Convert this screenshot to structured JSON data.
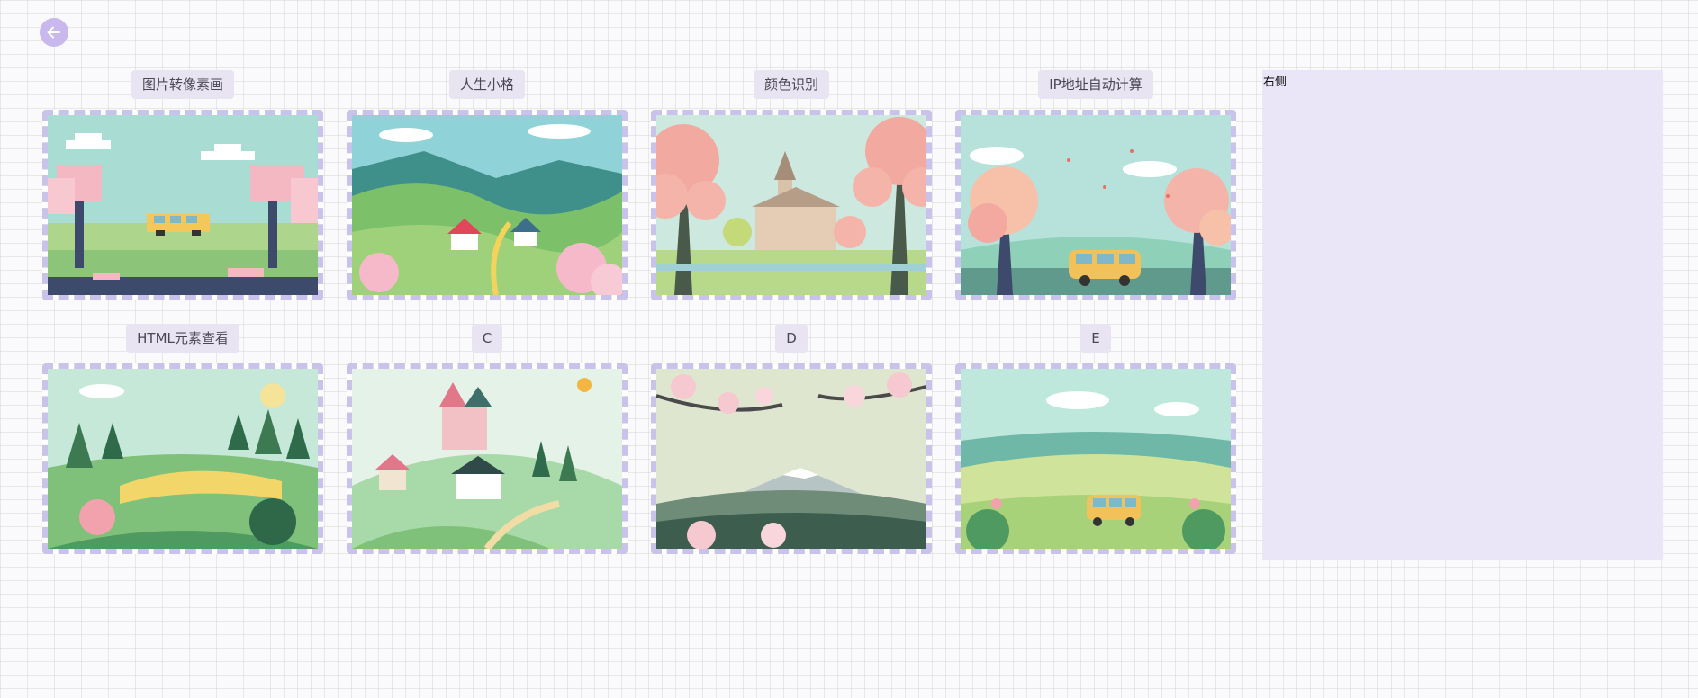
{
  "nav": {
    "back_icon": "arrow-left-icon"
  },
  "cards": [
    {
      "title": "图片转像素画",
      "scene": "pixel-art-van"
    },
    {
      "title": "人生小格",
      "scene": "green-hills-houses"
    },
    {
      "title": "颜色识别",
      "scene": "blossom-church"
    },
    {
      "title": "IP地址自动计算",
      "scene": "petals-van"
    },
    {
      "title": "HTML元素查看",
      "scene": "forest-meadow"
    },
    {
      "title": "C",
      "scene": "hill-castle-village"
    },
    {
      "title": "D",
      "scene": "blossom-mountain"
    },
    {
      "title": "E",
      "scene": "flower-field-van"
    }
  ],
  "right_panel": {
    "label": "右侧"
  },
  "colors": {
    "accent": "#c8b8ee",
    "frame_border": "#c9c3ec",
    "title_bg": "#e9e4f2",
    "panel_bg": "#ebe6f7"
  }
}
